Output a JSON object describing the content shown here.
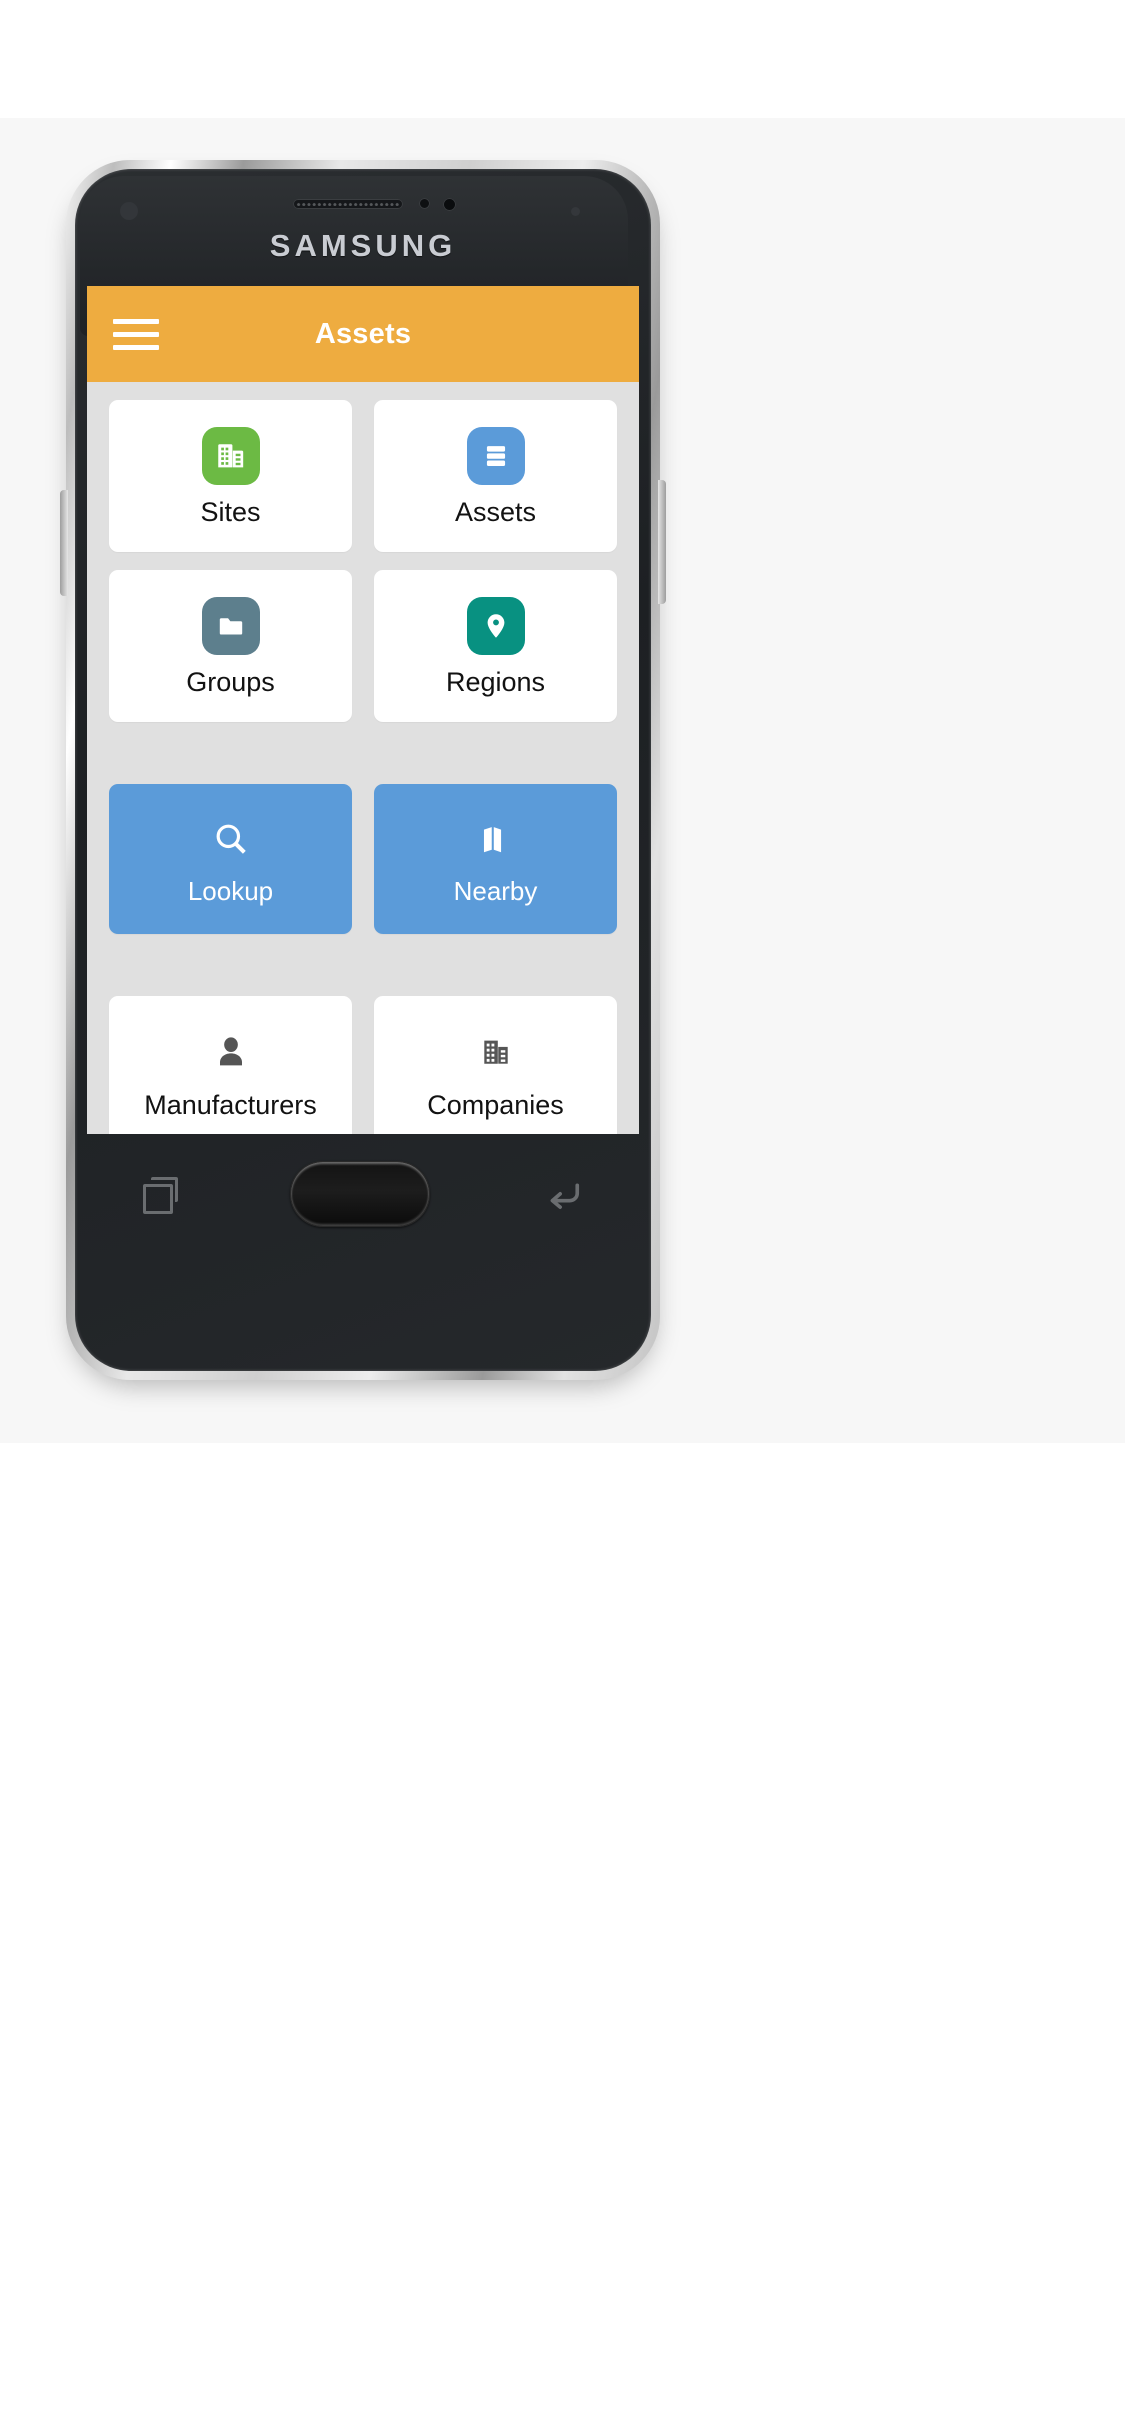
{
  "device": {
    "brand": "SAMSUNG",
    "hardware_keys": [
      {
        "name": "recents-key",
        "icon": "recents-icon"
      },
      {
        "name": "home-key",
        "icon": "home-button"
      },
      {
        "name": "back-key",
        "icon": "back-arrow-icon"
      }
    ]
  },
  "app": {
    "appbar": {
      "title": "Assets",
      "menu_icon": "hamburger-menu-icon",
      "background_color": "#eeac40",
      "title_color": "#ffffff"
    },
    "background_color": "#e0e0e0",
    "rows": [
      {
        "style": "card",
        "tiles": [
          {
            "label": "Sites",
            "icon": "building-icon",
            "badge_color": "#6cba44",
            "glyph_color": "#ffffff"
          },
          {
            "label": "Assets",
            "icon": "list-lines-icon",
            "badge_color": "#5b9bd9",
            "glyph_color": "#ffffff"
          }
        ]
      },
      {
        "style": "card",
        "tiles": [
          {
            "label": "Groups",
            "icon": "folder-icon",
            "badge_color": "#5d7f8d",
            "glyph_color": "#ffffff"
          },
          {
            "label": "Regions",
            "icon": "location-pin-icon",
            "badge_color": "#089181",
            "glyph_color": "#ffffff"
          }
        ]
      },
      {
        "style": "action",
        "tiles": [
          {
            "label": "Lookup",
            "icon": "search-icon",
            "background_color": "#5b9bd9",
            "glyph_color": "#ffffff"
          },
          {
            "label": "Nearby",
            "icon": "map-icon",
            "background_color": "#5b9bd9",
            "glyph_color": "#ffffff"
          }
        ]
      },
      {
        "style": "card",
        "tiles": [
          {
            "label": "Manufacturers",
            "icon": "person-icon",
            "glyph_color": "#555555"
          },
          {
            "label": "Companies",
            "icon": "office-building-icon",
            "glyph_color": "#555555"
          }
        ]
      }
    ],
    "bottom_bar": {
      "add_icon": "plus-icon",
      "add_color": "#f5a623",
      "background_color": "#e6e6ea"
    }
  }
}
